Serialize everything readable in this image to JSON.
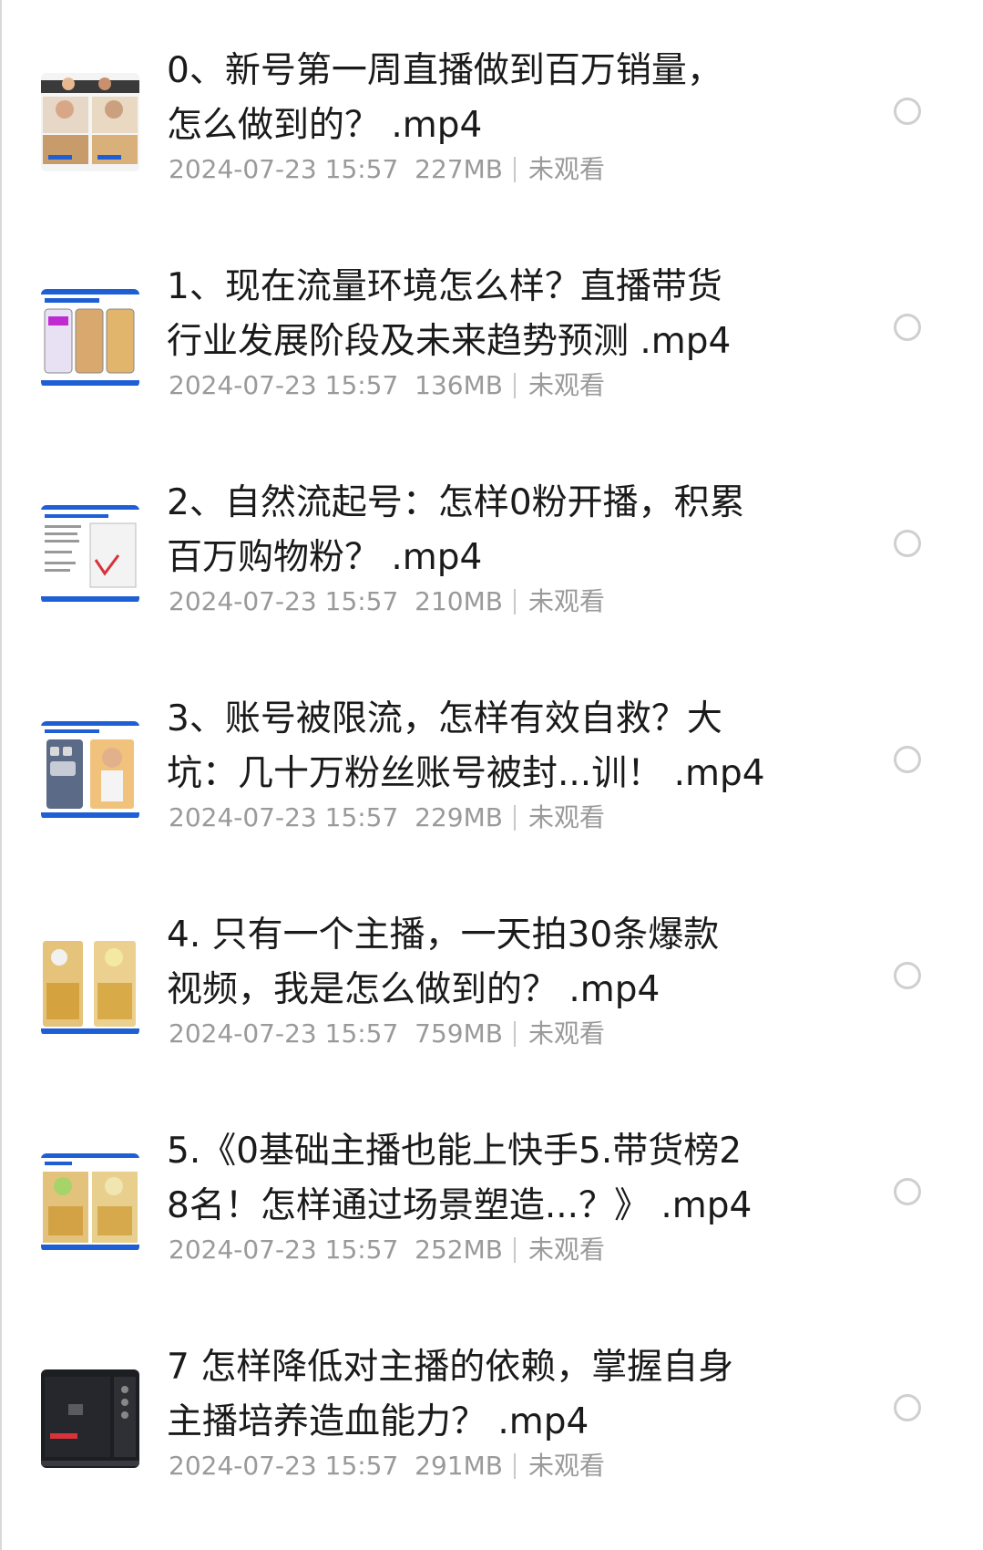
{
  "files": [
    {
      "title_lines": [
        "0、新号第一周直播做到百万销量，",
        "怎么做到的？ .mp4"
      ],
      "date": "2024-07-23 15:57",
      "size": "227MB",
      "status": "未观看",
      "thumbnail": "video-thumbnail-0"
    },
    {
      "title_lines": [
        "1、现在流量环境怎么样？直播带货",
        "行业发展阶段及未来趋势预测 .mp4"
      ],
      "date": "2024-07-23 15:57",
      "size": "136MB",
      "status": "未观看",
      "thumbnail": "video-thumbnail-1"
    },
    {
      "title_lines": [
        "2、自然流起号：怎样0粉开播，积累",
        "百万购物粉？ .mp4"
      ],
      "date": "2024-07-23 15:57",
      "size": "210MB",
      "status": "未观看",
      "thumbnail": "video-thumbnail-2"
    },
    {
      "title_lines": [
        "3、账号被限流，怎样有效自救？大",
        "坑：几十万粉丝账号被封...训！ .mp4"
      ],
      "date": "2024-07-23 15:57",
      "size": "229MB",
      "status": "未观看",
      "thumbnail": "video-thumbnail-3"
    },
    {
      "title_lines": [
        "4. 只有一个主播，一天拍30条爆款",
        "视频，我是怎么做到的？ .mp4"
      ],
      "date": "2024-07-23 15:57",
      "size": "759MB",
      "status": "未观看",
      "thumbnail": "video-thumbnail-4"
    },
    {
      "title_lines": [
        "5.《0基础主播也能上快手5.带货榜2",
        "8名！怎样通过场景塑造...？》 .mp4"
      ],
      "date": "2024-07-23 15:57",
      "size": "252MB",
      "status": "未观看",
      "thumbnail": "video-thumbnail-5"
    },
    {
      "title_lines": [
        "7 怎样降低对主播的依赖，掌握自身",
        "主播培养造血能力？ .mp4"
      ],
      "date": "2024-07-23 15:57",
      "size": "291MB",
      "status": "未观看",
      "thumbnail": "video-thumbnail-7"
    }
  ],
  "colors": {
    "title": "#1a1a1a",
    "meta": "#9a9a9a",
    "radio_border": "#cfcfcf",
    "thumb_accent": "#1f5fd6"
  }
}
